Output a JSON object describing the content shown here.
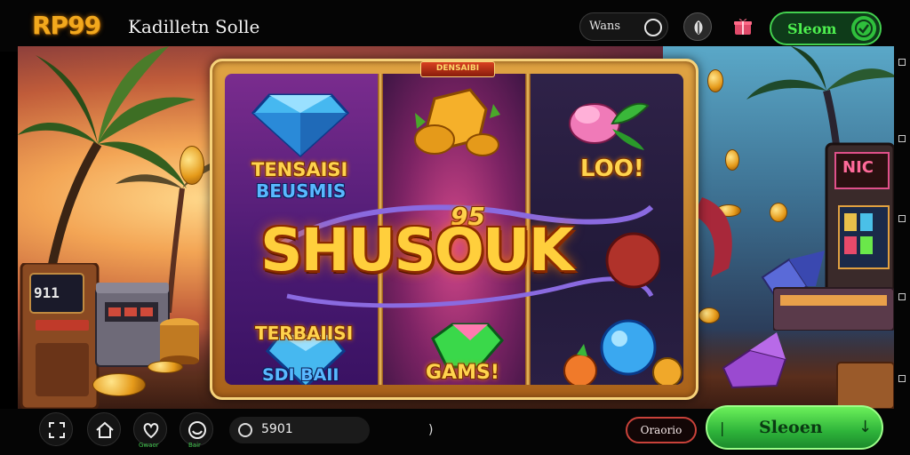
{
  "header": {
    "logo": "RP99",
    "site_title": "Kadilletn Solle",
    "pill_label": "Wans",
    "signin_label": "Sleom"
  },
  "board": {
    "banner": "DENSAIBI",
    "panel1_line1": "TENSAISI",
    "panel1_line2": "BEUSMIS",
    "panel3_text": "LOO!",
    "title_badge": "95",
    "title": "SHUSOUK",
    "panel4_line1": "TERBAIISI",
    "panel4_line2": "SDI BAII",
    "panel5_text": "GAMS!"
  },
  "scene": {
    "arcade_left_screen": "911",
    "arcade_right_screen": "NIC"
  },
  "bottom": {
    "nav": [
      {
        "icon": "expand-icon",
        "label": ""
      },
      {
        "icon": "home-icon",
        "label": ""
      },
      {
        "icon": "heart-icon",
        "label": "Gwaor"
      },
      {
        "icon": "smile-icon",
        "label": "Bair"
      }
    ],
    "balance_value": "5901",
    "tick_text": ")",
    "promo_label": "Oraorio",
    "signup_prefix": "|",
    "signup_label": "Sleoen",
    "signup_suffix": "↓"
  },
  "colors": {
    "logo": "#f2a81d",
    "signin_accent": "#43d14f",
    "signup_green": "#2eb33a",
    "promo_border": "#c9423a",
    "board_gold": "#e0a443"
  }
}
